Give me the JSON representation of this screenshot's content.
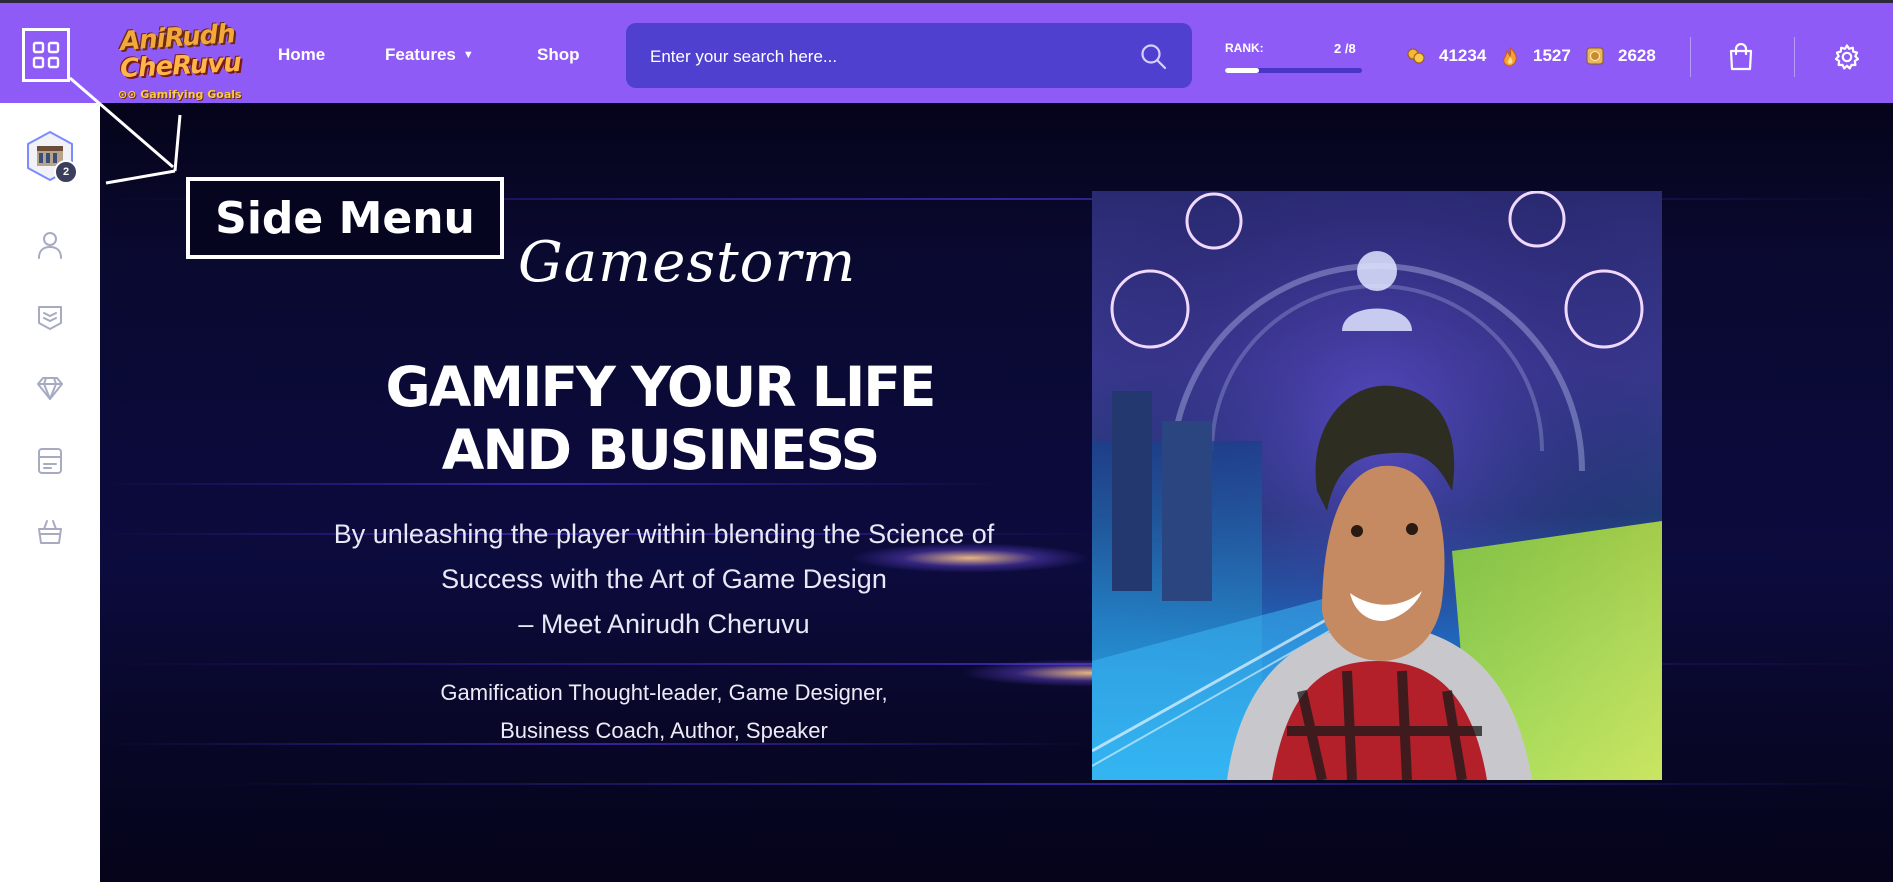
{
  "header": {
    "logo": {
      "line1": "AniRudh",
      "line2": "CheRuvu",
      "tagline": "Gamifying Goals"
    },
    "nav": [
      {
        "label": "Home"
      },
      {
        "label": "Features"
      },
      {
        "label": "Shop"
      }
    ],
    "search": {
      "placeholder": "Enter your search here..."
    },
    "rank": {
      "label": "RANK:",
      "value": "2 /8",
      "progress_fraction": 0.25
    },
    "stats": [
      {
        "icon": "coin-icon",
        "value": "41234"
      },
      {
        "icon": "flame-icon",
        "value": "1527"
      },
      {
        "icon": "badge-icon",
        "value": "2628"
      }
    ]
  },
  "sidebar": {
    "avatar_badge": "2",
    "items": [
      {
        "icon": "user-icon"
      },
      {
        "icon": "stack-icon"
      },
      {
        "icon": "diamond-icon"
      },
      {
        "icon": "card-icon"
      },
      {
        "icon": "basket-icon"
      }
    ]
  },
  "hero": {
    "brand": "Gamestorm",
    "headline_line1": "GAMIFY YOUR LIFE",
    "headline_line2": "AND BUSINESS",
    "tagline_line1": "By unleashing the player within blending the Science of",
    "tagline_line2": "Success with the Art of Game Design",
    "tagline_line3": "– Meet Anirudh Cheruvu",
    "roles_line1": "Gamification Thought-leader, Game Designer,",
    "roles_line2": "Business Coach, Author, Speaker"
  },
  "annotation": {
    "label": "Side Menu"
  },
  "colors": {
    "topbar": "#8e5bf7",
    "search": "#5040cf",
    "hero_bg": "#06051f",
    "sidebar": "#ffffff"
  }
}
